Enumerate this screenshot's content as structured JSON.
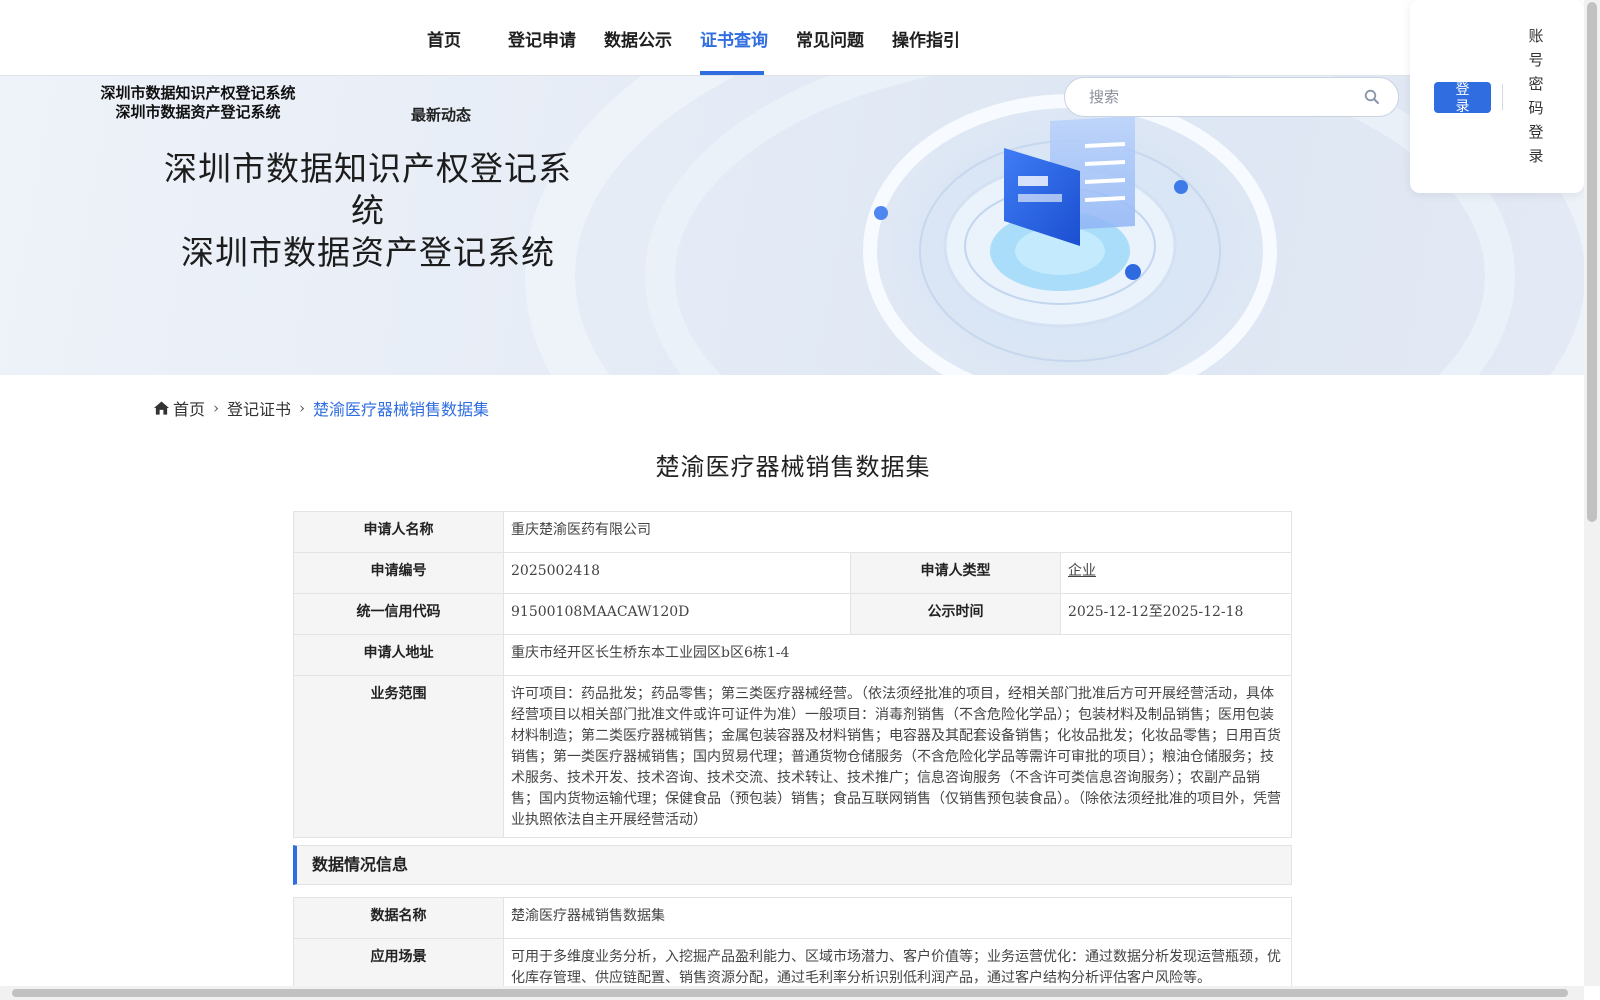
{
  "nav": {
    "items": [
      {
        "label": "首页"
      },
      {
        "label": "登记申请"
      },
      {
        "label": "数据公示"
      },
      {
        "label": "证书查询"
      },
      {
        "label": "常见问题"
      },
      {
        "label": "操作指引"
      }
    ],
    "active_index": 3
  },
  "brand": {
    "line1": "深圳市数据知识产权登记系统",
    "line2": "深圳市数据资产登记系统"
  },
  "latest_label": "最新动态",
  "banner": {
    "title_line1": "深圳市数据知识产权登记系统",
    "title_line2": "深圳市数据资产登记系统"
  },
  "search": {
    "placeholder": "搜索",
    "icon": "search-icon"
  },
  "login": {
    "button_label": "登录",
    "password_login_label": "账号密码登录"
  },
  "breadcrumb": {
    "home": "首页",
    "level2": "登记证书",
    "current": "楚渝医疗器械销售数据集"
  },
  "page_title": "楚渝医疗器械销售数据集",
  "applicant": {
    "name_label": "申请人名称",
    "name": "重庆楚渝医药有限公司",
    "number_label": "申请编号",
    "number": "2025002418",
    "type_label": "申请人类型",
    "type": "企业",
    "credit_label": "统一信用代码",
    "credit": "91500108MAACAW120D",
    "publicity_label": "公示时间",
    "publicity": "2025-12-12至2025-12-18",
    "address_label": "申请人地址",
    "address": "重庆市经开区长生桥东本工业园区b区6栋1-4",
    "scope_label": "业务范围",
    "scope": "许可项目：药品批发；药品零售；第三类医疗器械经营。（依法须经批准的项目，经相关部门批准后方可开展经营活动，具体经营项目以相关部门批准文件或许可证件为准）一般项目：消毒剂销售（不含危险化学品）；包装材料及制品销售；医用包装材料制造；第二类医疗器械销售；金属包装容器及材料销售；电容器及其配套设备销售；化妆品批发；化妆品零售；日用百货销售；第一类医疗器械销售；国内贸易代理；普通货物仓储服务（不含危险化学品等需许可审批的项目）；粮油仓储服务；技术服务、技术开发、技术咨询、技术交流、技术转让、技术推广；信息咨询服务（不含许可类信息咨询服务）；农副产品销售；国内货物运输代理；保健食品（预包装）销售；食品互联网销售（仅销售预包装食品）。（除依法须经批准的项目外，凭营业执照依法自主开展经营活动）"
  },
  "data_section": {
    "heading": "数据情况信息",
    "data_name_label": "数据名称",
    "data_name": "楚渝医疗器械销售数据集",
    "scenario_label": "应用场景",
    "scenario": "可用于多维度业务分析，入挖掘产品盈利能力、区域市场潜力、客户价值等；业务运营优化：通过数据分析发现运营瓶颈，优化库存管理、供应链配置、销售资源分配，通过毛利率分析识别低利润产品，通过客户结构分析评估客户风险等。"
  },
  "colors": {
    "accent": "#2f6de0",
    "label_bg": "#f5f5f5",
    "border": "#e3e3e3"
  }
}
